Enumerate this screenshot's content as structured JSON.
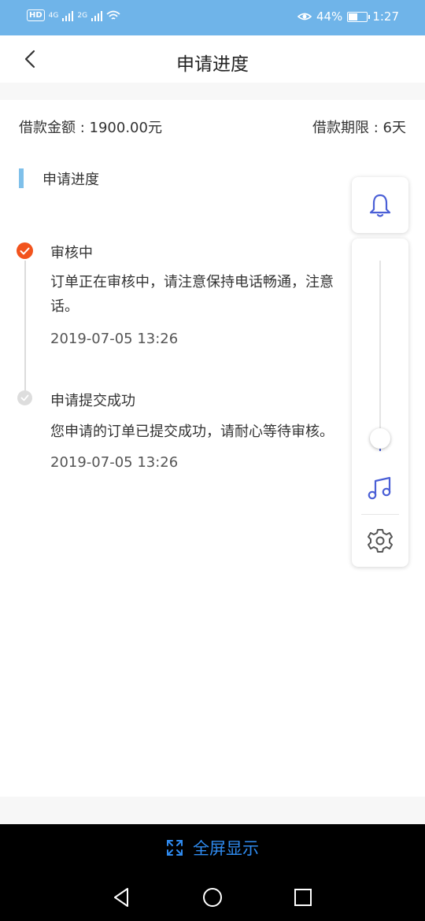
{
  "status_bar": {
    "left_indicators": [
      "HD",
      "4G",
      "2G"
    ],
    "battery_percent": "44%",
    "battery_level": 0.44,
    "time": "1:27"
  },
  "nav": {
    "title": "申请进度",
    "back_icon": "chevron-left-icon"
  },
  "loan": {
    "amount_text": "借款金额 : 1900.00元",
    "term_text": "借款期限 : 6天"
  },
  "section": {
    "title": "申请进度",
    "accent_color": "#7fc0ea"
  },
  "timeline": [
    {
      "title": "审核中",
      "desc_line1": "订单正在审核中，请注意保持电话畅通，注意",
      "desc_line2": "话。",
      "time": "2019-07-05 13:26",
      "status": "active",
      "status_color": "#f2531d"
    },
    {
      "title": "申请提交成功",
      "desc_line1": "您申请的订单已提交成功，请耐心等待审核。",
      "time": "2019-07-05 13:26",
      "status": "done"
    }
  ],
  "float_panel": {
    "icons": [
      "bell-icon",
      "music-note-icon",
      "gear-icon"
    ],
    "volume_level": 0.02
  },
  "fullscreen": {
    "label": "全屏显示",
    "color": "#2f8bf0"
  },
  "system_nav": {
    "icons": [
      "back-triangle-icon",
      "home-circle-icon",
      "recents-square-icon"
    ]
  }
}
